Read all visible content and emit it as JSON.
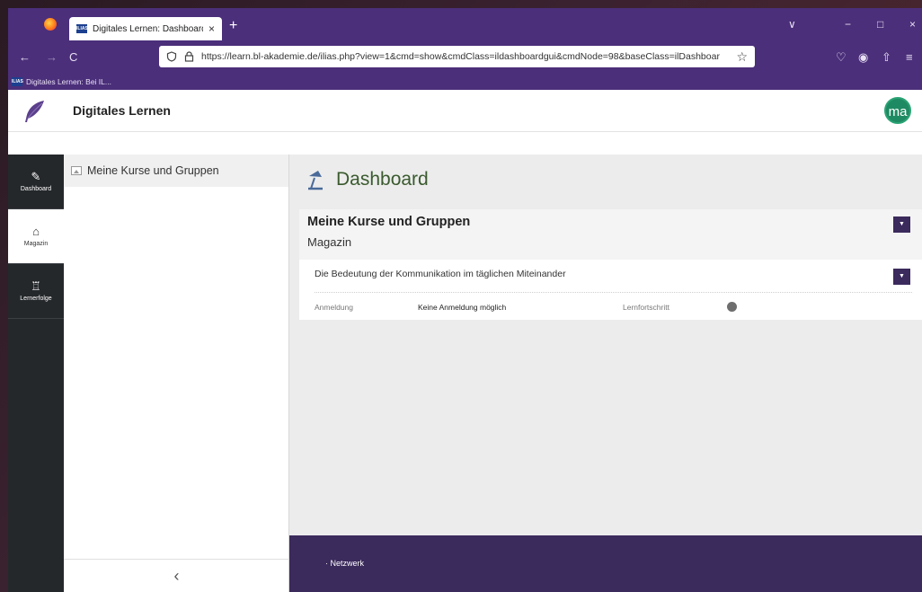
{
  "browser": {
    "tab_title": "Digitales Lernen: Dashboard",
    "tab_close": "×",
    "new_tab": "+",
    "url": "https://learn.bl-akademie.de/ilias.php?view=1&cmd=show&cmdClass=ildashboardgui&cmdNode=98&baseClass=ilDashboar",
    "favicon_text": "ILIAS",
    "bookmark_label": "Digitales Lernen: Bei IL...",
    "icons": {
      "back": "←",
      "forward": "→",
      "reload": "C",
      "chevron": "∨",
      "minimize": "−",
      "maximize": "□",
      "close": "×",
      "star": "☆",
      "pocket": "♡",
      "account": "◉",
      "extensions": "⇧",
      "menu": "≡"
    }
  },
  "app": {
    "title": "Digitales Lernen",
    "avatar": "ma"
  },
  "mainbar": {
    "items": [
      {
        "label": "Dashboard",
        "icon": "✎"
      },
      {
        "label": "Magazin",
        "icon": "⌂"
      },
      {
        "label": "Lernerfolge",
        "icon": "♖"
      }
    ]
  },
  "slate": {
    "entry": "Meine Kurse und Gruppen",
    "collapse": "‹"
  },
  "page": {
    "title": "Dashboard",
    "panel_title": "Meine Kurse und Gruppen",
    "panel_subtitle": "Magazin",
    "item_title": "Die Bedeutung der Kommunikation im täglichen Miteinander",
    "props": {
      "registration_label": "Anmeldung",
      "registration_value": "Keine Anmeldung möglich",
      "progress_label": "Lernfortschritt"
    },
    "dropdown_glyph": "▼"
  },
  "footer": {
    "link": "· Netzwerk"
  },
  "colors": {
    "browser_chrome": "#4b2f7a",
    "mainbar": "#25282b",
    "footer": "#3b2a5c",
    "title_green": "#3a5a2e",
    "avatar_green": "#1e8a63"
  }
}
